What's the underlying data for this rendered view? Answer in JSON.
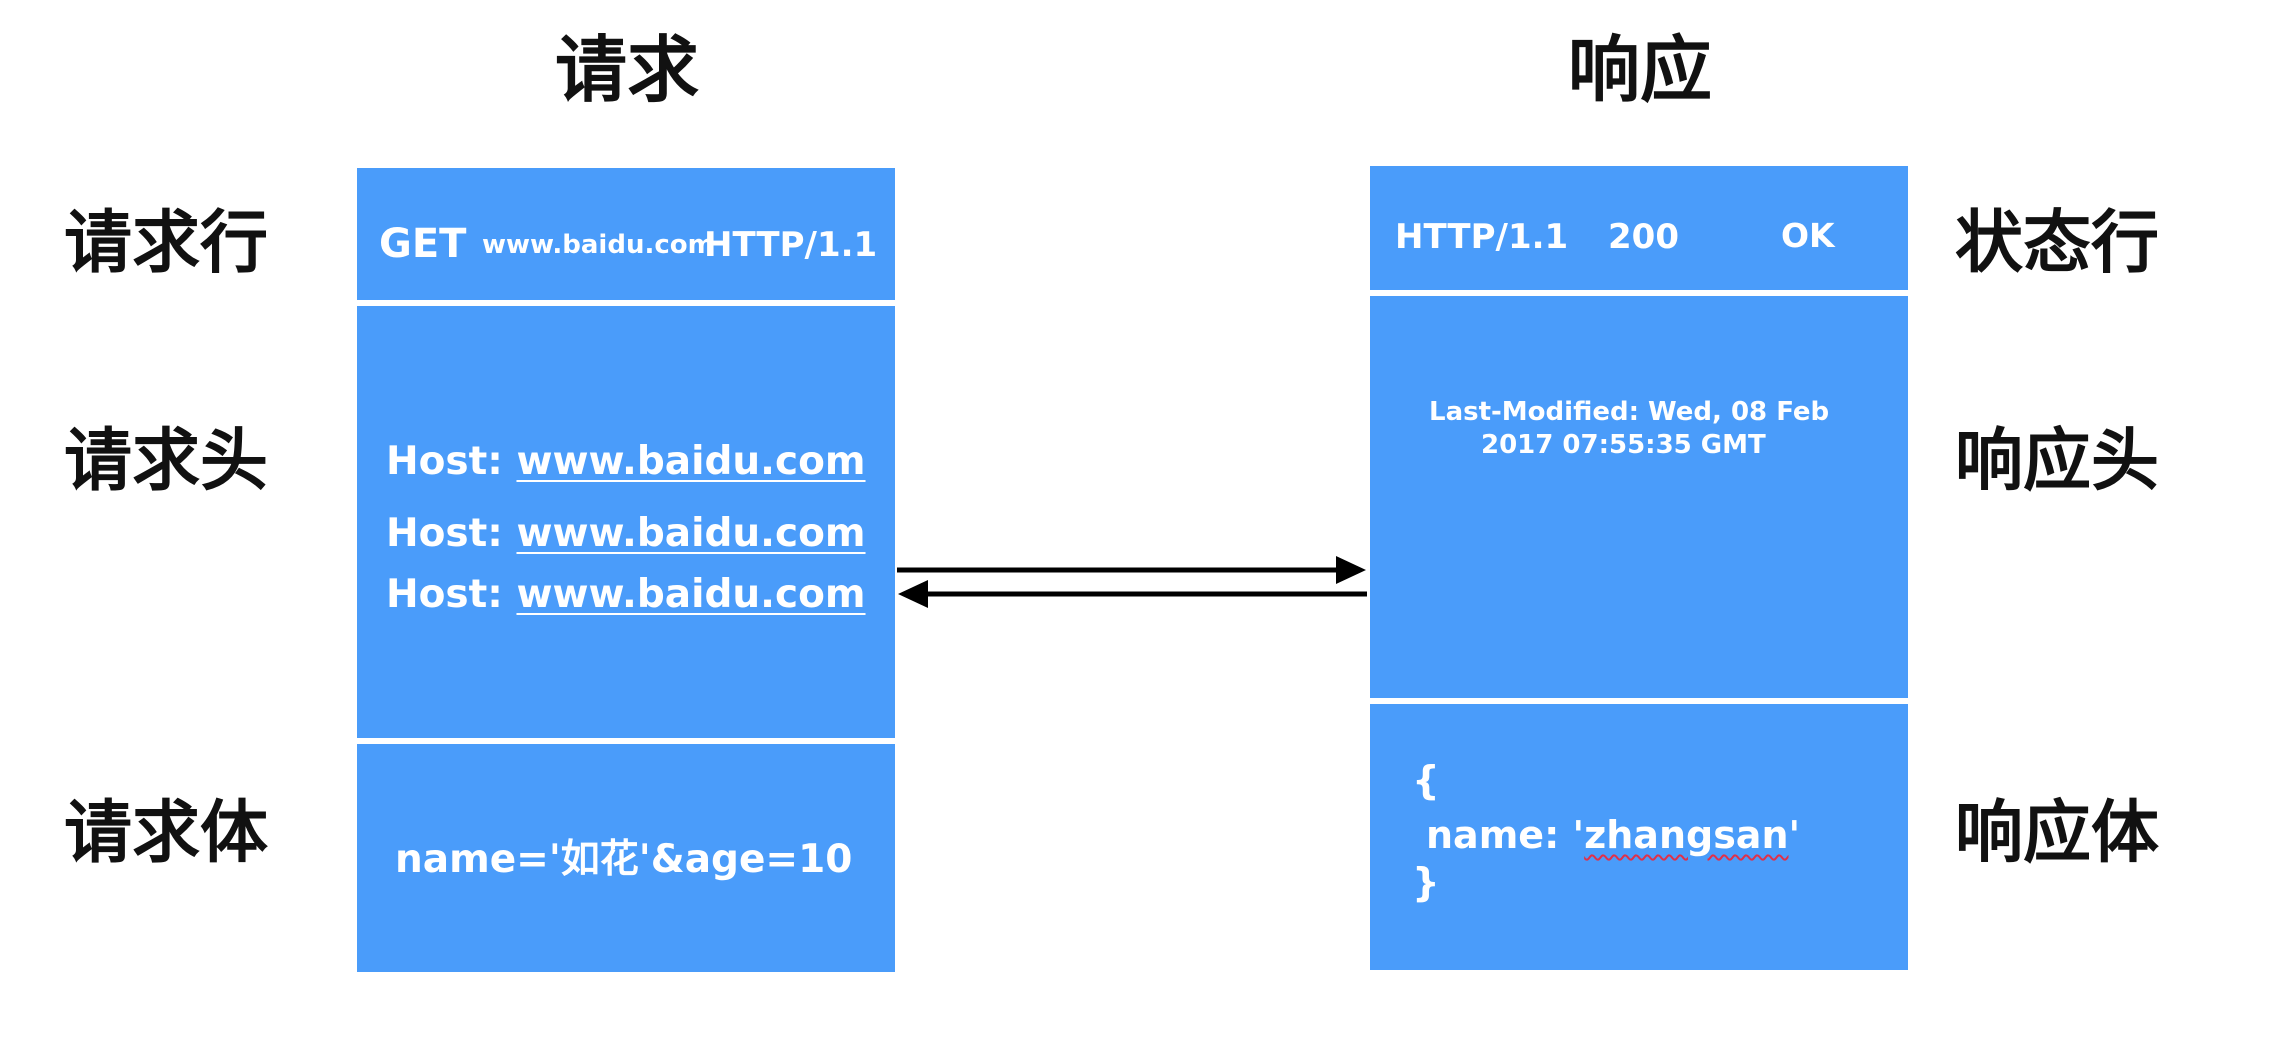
{
  "headings": {
    "request": "请求",
    "response": "响应"
  },
  "left_labels": {
    "request_line": "请求行",
    "request_headers": "请求头",
    "request_body": "请求体"
  },
  "right_labels": {
    "status_line": "状态行",
    "response_headers": "响应头",
    "response_body": "响应体"
  },
  "request": {
    "line": {
      "method": "GET",
      "url": "www.baidu.com",
      "version": "HTTP/1.1"
    },
    "headers": [
      {
        "name": "Host: ",
        "value": "www.baidu.com"
      },
      {
        "name": "Host: ",
        "value": "www.baidu.com"
      },
      {
        "name": "Host: ",
        "value": "www.baidu.com"
      }
    ],
    "body": "name='如花'&age=10"
  },
  "response": {
    "status": {
      "version": "HTTP/1.1",
      "code": "200",
      "text": "OK"
    },
    "headers": {
      "line1": "Last-Modified: Wed, 08 Feb",
      "line2": "2017 07:55:35 GMT"
    },
    "body": {
      "open": "{",
      "key": "name: '",
      "value": "zhangsan",
      "close_quote": "'",
      "close": "}"
    }
  },
  "colors": {
    "box": "#4a9cfa",
    "text": "#111111",
    "arrow": "#000000",
    "spellcheck": "#e0304a"
  }
}
